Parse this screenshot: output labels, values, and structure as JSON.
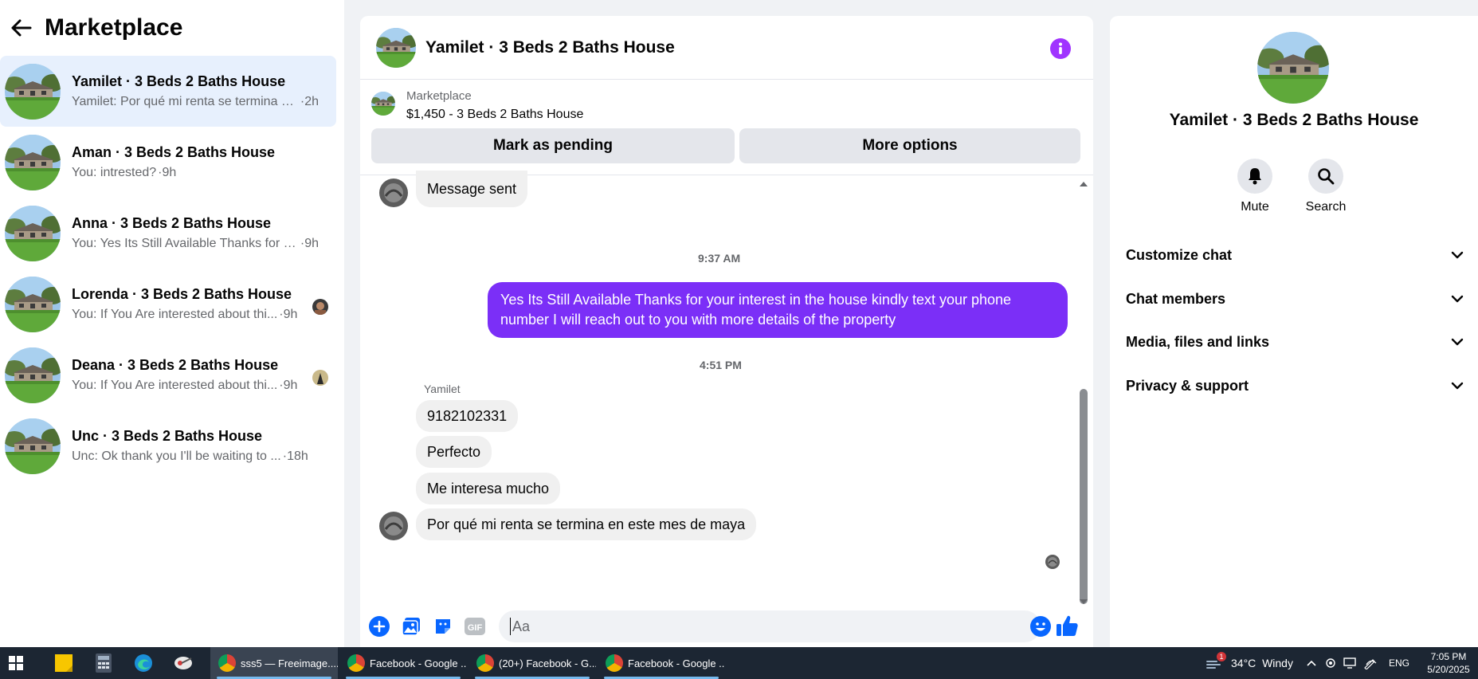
{
  "sidebar": {
    "title": "Marketplace",
    "conversations": [
      {
        "name": "Yamilet · 3 Beds 2 Baths House",
        "snippet": "Yamilet: Por qué mi renta se termina e...",
        "time": "·2h",
        "active": true
      },
      {
        "name": "Aman · 3 Beds 2 Baths House",
        "snippet": "You: intrested?",
        "time": "·9h"
      },
      {
        "name": "Anna · 3 Beds 2 Baths House",
        "snippet": "You: Yes Its Still Available Thanks for y...",
        "time": "·9h"
      },
      {
        "name": "Lorenda · 3 Beds 2 Baths House",
        "snippet": "You: If You Are interested about thi...",
        "time": "·9h"
      },
      {
        "name": "Deana · 3 Beds 2 Baths House",
        "snippet": "You: If You Are interested about thi...",
        "time": "·9h"
      },
      {
        "name": "Unc · 3 Beds 2 Baths House",
        "snippet": "Unc: Ok thank you I'll be waiting to ...",
        "time": "·18h"
      }
    ]
  },
  "chat": {
    "title": "Yamilet · 3 Beds 2 Baths House",
    "listing": {
      "label": "Marketplace",
      "price_title": "$1,450 - 3 Beds 2 Baths House",
      "pending_button": "Mark as pending",
      "more_button": "More options"
    },
    "messages": {
      "sent_status": "Message sent",
      "time_1": "9:37 AM",
      "outgoing_1": "Yes Its Still Available Thanks for your interest in the house kindly text your phone number I will reach out to you with more details of the property",
      "time_2": "4:51 PM",
      "sender": "Yamilet",
      "incoming_1": "9182102331",
      "incoming_2": "Perfecto",
      "incoming_3": "Me interesa mucho",
      "incoming_4": "Por qué mi renta se termina en este mes de maya"
    },
    "composer": {
      "placeholder": "Aa"
    }
  },
  "right_panel": {
    "title": "Yamilet · 3 Beds 2 Baths House",
    "mute_label": "Mute",
    "search_label": "Search",
    "sections": [
      "Customize chat",
      "Chat members",
      "Media, files and links",
      "Privacy & support"
    ]
  },
  "taskbar": {
    "apps": [
      {
        "label": "sss5 — Freeimage....",
        "active": true
      },
      {
        "label": "Facebook - Google ..."
      },
      {
        "label": "(20+) Facebook - G..."
      },
      {
        "label": "Facebook - Google ..."
      }
    ],
    "weather": "34°C  Windy",
    "language": "ENG",
    "time": "7:05 PM",
    "date": "5/20/2025",
    "notification_count": "1"
  },
  "colors": {
    "accent": "#7b2ff7",
    "facebook_blue": "#0866ff",
    "info_purple": "#a033ff"
  }
}
